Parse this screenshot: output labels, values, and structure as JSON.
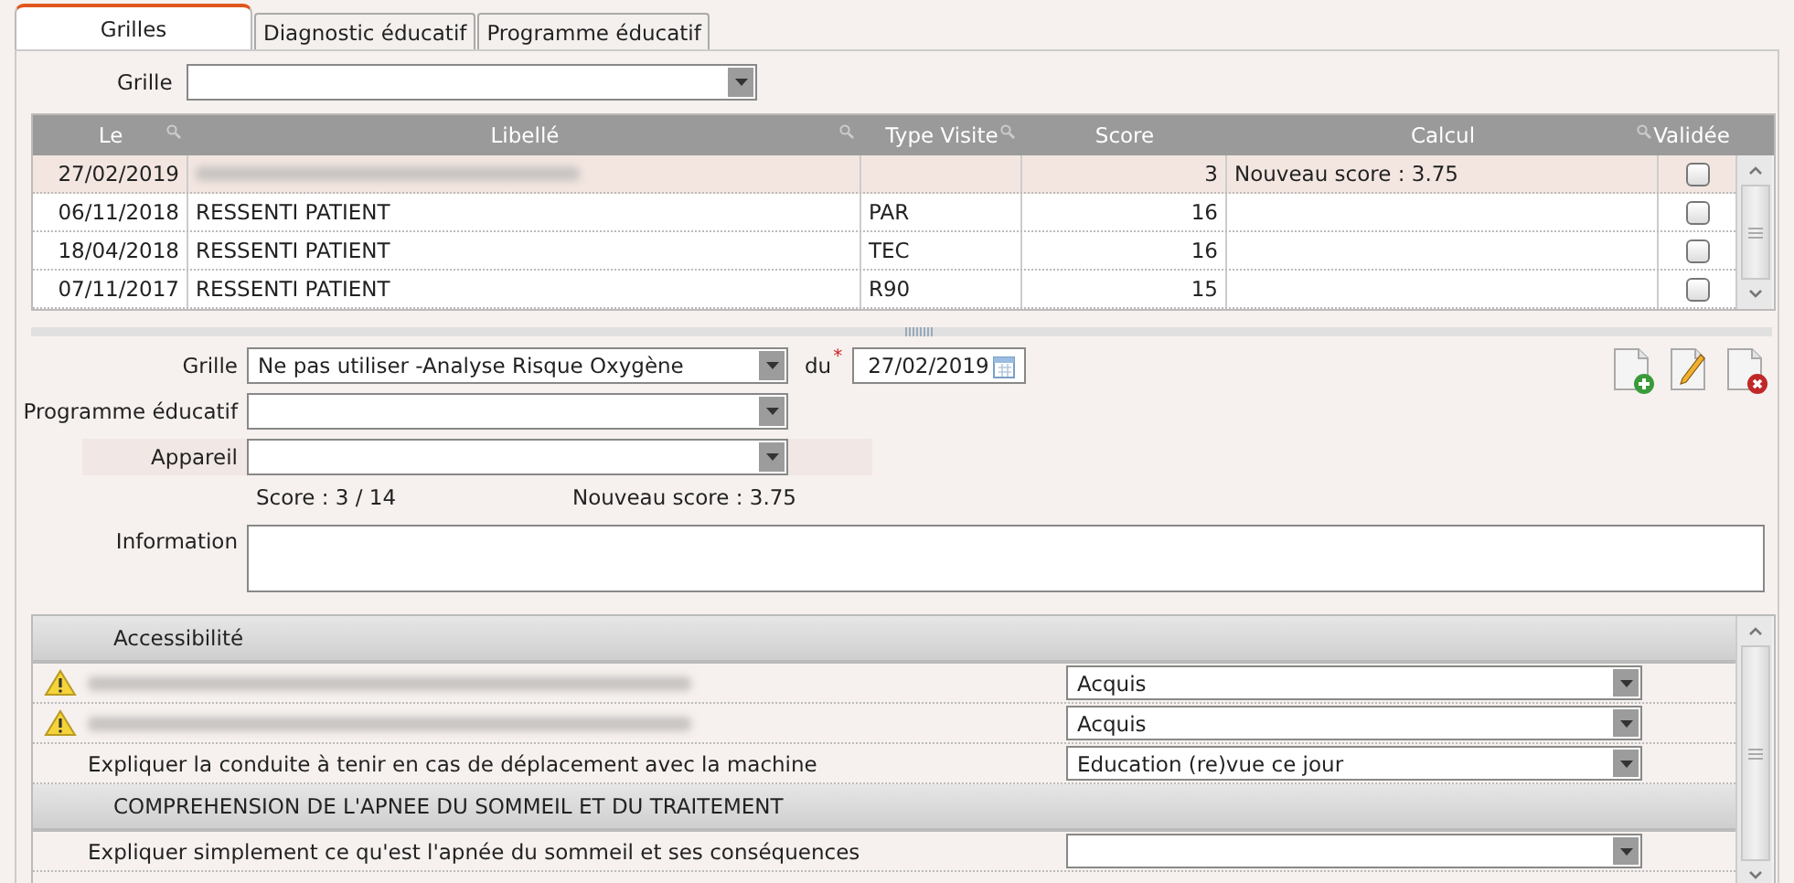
{
  "tabs": [
    {
      "label": "Grilles",
      "selected": true
    },
    {
      "label": "Diagnostic éducatif",
      "selected": false
    },
    {
      "label": "Programme éducatif",
      "selected": false
    }
  ],
  "filter": {
    "label": "Grille"
  },
  "table": {
    "columns": [
      "Le",
      "Libellé",
      "Type Visite",
      "Score",
      "Calcul",
      "Validée"
    ],
    "rows": [
      {
        "date": "27/02/2019",
        "redacted": true,
        "score": "3",
        "calcul": "Nouveau score  : 3.75",
        "checked": false,
        "selected": true
      },
      {
        "date": "06/11/2018",
        "label": "RESSENTI PATIENT",
        "redacted": false,
        "type": "PAR",
        "score": "16",
        "checked": false,
        "selected": false
      },
      {
        "date": "18/04/2018",
        "label": "RESSENTI PATIENT",
        "redacted": false,
        "type": "TEC",
        "score": "16",
        "checked": false,
        "selected": false
      },
      {
        "date": "07/11/2017",
        "label": "RESSENTI PATIENT",
        "redacted": false,
        "type": "R90",
        "score": "15",
        "checked": false,
        "selected": false
      }
    ]
  },
  "form": {
    "grille": {
      "label": "Grille",
      "value": "Ne pas utiliser -Analyse Risque Oxygène"
    },
    "date": {
      "label": "du",
      "required_mark": "*",
      "value": "27/02/2019"
    },
    "programme": {
      "label": "Programme éducatif"
    },
    "appareil": {
      "label": "Appareil"
    },
    "score": "Score : 3 / 14",
    "new_score": "Nouveau score  : 3.75",
    "information": {
      "label": "Information"
    }
  },
  "items": [
    {
      "kind": "section",
      "label": "Accessibilité"
    },
    {
      "kind": "item",
      "redacted": true,
      "warning": true,
      "value": "Acquis"
    },
    {
      "kind": "item",
      "redacted": true,
      "warning": true,
      "value": "Acquis"
    },
    {
      "kind": "item",
      "label": "Expliquer la conduite à tenir en cas de déplacement avec la machine",
      "redacted": false,
      "warning": false,
      "value": "Education (re)vue ce jour"
    },
    {
      "kind": "section",
      "label": "COMPREHENSION DE L'APNEE DU SOMMEIL ET DU TRAITEMENT"
    },
    {
      "kind": "item",
      "label": "Expliquer simplement ce qu'est l'apnée du sommeil et ses conséquences",
      "redacted": false,
      "warning": false,
      "value": null
    }
  ]
}
